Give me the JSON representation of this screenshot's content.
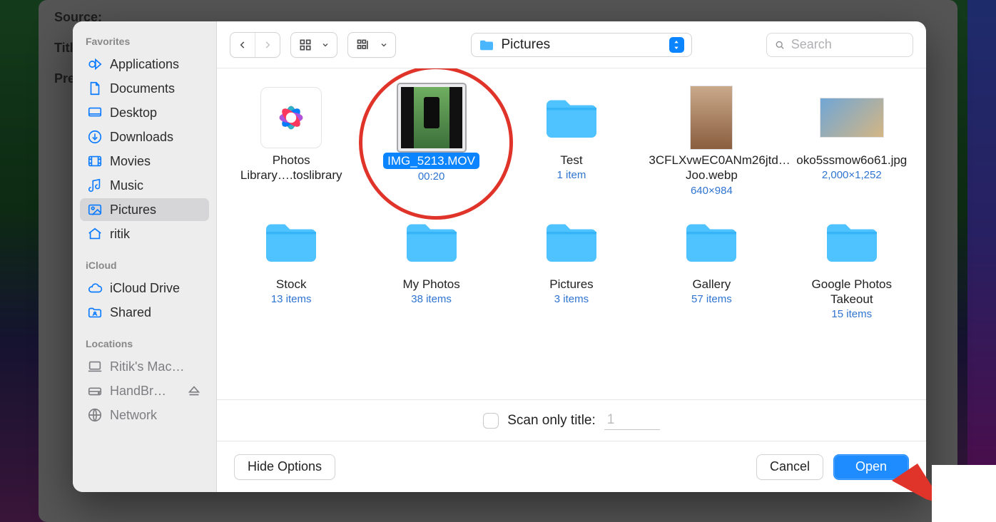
{
  "background_form": {
    "row1": "Source:",
    "row2": "Title",
    "row3": "Pres"
  },
  "sidebar": {
    "sections": [
      {
        "label": "Favorites",
        "items": [
          {
            "name": "Applications",
            "icon": "apps"
          },
          {
            "name": "Documents",
            "icon": "doc"
          },
          {
            "name": "Desktop",
            "icon": "desktop"
          },
          {
            "name": "Downloads",
            "icon": "download"
          },
          {
            "name": "Movies",
            "icon": "movie"
          },
          {
            "name": "Music",
            "icon": "music"
          },
          {
            "name": "Pictures",
            "icon": "picture",
            "selected": true
          },
          {
            "name": "ritik",
            "icon": "home"
          }
        ]
      },
      {
        "label": "iCloud",
        "items": [
          {
            "name": "iCloud Drive",
            "icon": "cloud"
          },
          {
            "name": "Shared",
            "icon": "shared"
          }
        ]
      },
      {
        "label": "Locations",
        "items": [
          {
            "name": "Ritik's Mac…",
            "icon": "laptop"
          },
          {
            "name": "HandBr… ",
            "icon": "disk",
            "eject": true
          },
          {
            "name": "Network",
            "icon": "globe"
          }
        ]
      }
    ]
  },
  "toolbar": {
    "path_label": "Pictures",
    "search_placeholder": "Search"
  },
  "files": [
    {
      "kind": "library",
      "name": "Photos Library….toslibrary"
    },
    {
      "kind": "video",
      "name": "IMG_5213.MOV",
      "meta": "00:20",
      "selected": true
    },
    {
      "kind": "folder",
      "name": "Test",
      "meta": "1 item"
    },
    {
      "kind": "image",
      "name": "3CFLXvwEC0ANm26jtd…Joo.webp",
      "meta": "640×984"
    },
    {
      "kind": "image",
      "name": "oko5ssmow6o61.jpg",
      "meta": "2,000×1,252"
    },
    {
      "kind": "folder",
      "name": "Stock",
      "meta": "13 items"
    },
    {
      "kind": "folder",
      "name": "My Photos",
      "meta": "38 items"
    },
    {
      "kind": "folder",
      "name": "Pictures",
      "meta": "3 items"
    },
    {
      "kind": "folder",
      "name": "Gallery",
      "meta": "57 items"
    },
    {
      "kind": "folder",
      "name": "Google Photos Takeout",
      "meta": "15 items"
    }
  ],
  "options": {
    "scan_label": "Scan only title:",
    "scan_value": "1"
  },
  "footer": {
    "hide_options": "Hide Options",
    "cancel": "Cancel",
    "open": "Open"
  }
}
